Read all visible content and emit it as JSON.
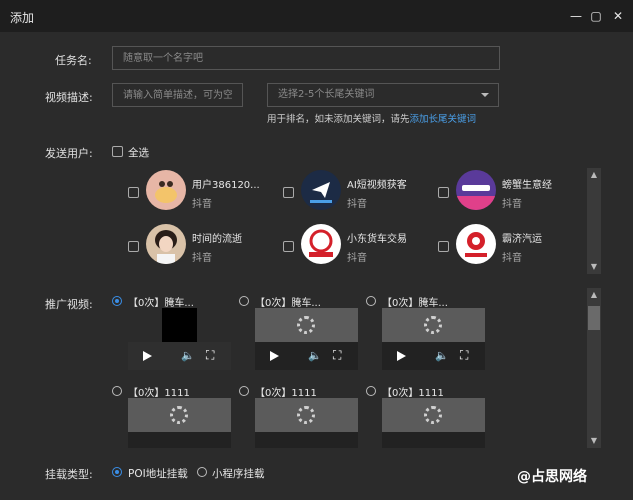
{
  "window": {
    "title": "添加",
    "min": "—",
    "max": "▢",
    "close": "✕"
  },
  "form": {
    "task_label": "任务名:",
    "task_placeholder": "随意取一个名字吧",
    "desc_label": "视频描述:",
    "desc_placeholder": "请输入简单描述，可为空",
    "keyword_placeholder": "选择2-5个长尾关键词",
    "hint_text": "用于排名，如未添加关键词，请先",
    "hint_link": "添加长尾关键词",
    "send_label": "发送用户:",
    "select_all": "全选",
    "promo_label": "推广视频:",
    "mount_label": "挂载类型:"
  },
  "users": [
    {
      "name": "用户386120...",
      "platform": "抖音",
      "avatar_color": "#e7b6a6"
    },
    {
      "name": "AI短视频获客",
      "platform": "抖音",
      "avatar_color": "#1c2b45"
    },
    {
      "name": "螃蟹生意经",
      "platform": "抖音",
      "avatar_color": "#5a3a9a"
    },
    {
      "name": "时间的流逝",
      "platform": "抖音",
      "avatar_color": "#d9c2a8"
    },
    {
      "name": "小东货车交易",
      "platform": "抖音",
      "avatar_color": "#ffffff"
    },
    {
      "name": "霸济汽运",
      "platform": "抖音",
      "avatar_color": "#ffffff"
    }
  ],
  "videos": [
    {
      "title": "【0次】腌车..."
    },
    {
      "title": "【0次】腌车..."
    },
    {
      "title": "【0次】腌车..."
    },
    {
      "title": "【0次】1111"
    },
    {
      "title": "【0次】1111"
    },
    {
      "title": "【0次】1111"
    }
  ],
  "mount_options": [
    {
      "label": "POI地址挂载",
      "selected": true
    },
    {
      "label": "小程序挂载",
      "selected": false
    }
  ],
  "watermark": "@占思网络",
  "colors": {
    "accent": "#3a8ee6",
    "link": "#4a9fe8",
    "bg": "#2b2b2b",
    "titlebar": "#1e1e1e"
  }
}
